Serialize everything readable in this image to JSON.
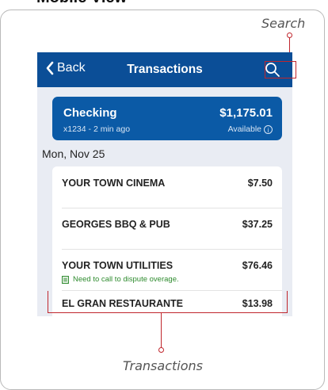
{
  "header": {
    "title": "Mobile View"
  },
  "callouts": {
    "search": "Search",
    "transactions": "Transactions"
  },
  "nav": {
    "back_label": "Back",
    "title": "Transactions"
  },
  "account": {
    "name": "Checking",
    "subtitle": "x1234 - 2 min ago",
    "balance": "$1,175.01",
    "available_label": "Available"
  },
  "date_header": "Mon, Nov 25",
  "transactions": [
    {
      "name": "YOUR TOWN CINEMA",
      "amount": "$7.50"
    },
    {
      "name": "GEORGES BBQ & PUB",
      "amount": "$37.25"
    },
    {
      "name": "YOUR TOWN UTILITIES",
      "amount": "$76.46",
      "note": "Need to call to dispute overage."
    },
    {
      "name": "EL GRAN RESTAURANTE",
      "amount": "$13.98"
    }
  ],
  "colors": {
    "navbar": "#0b4e97",
    "account_card": "#0b5aa6",
    "callout": "#c0262d",
    "note": "#2e8b2e"
  }
}
